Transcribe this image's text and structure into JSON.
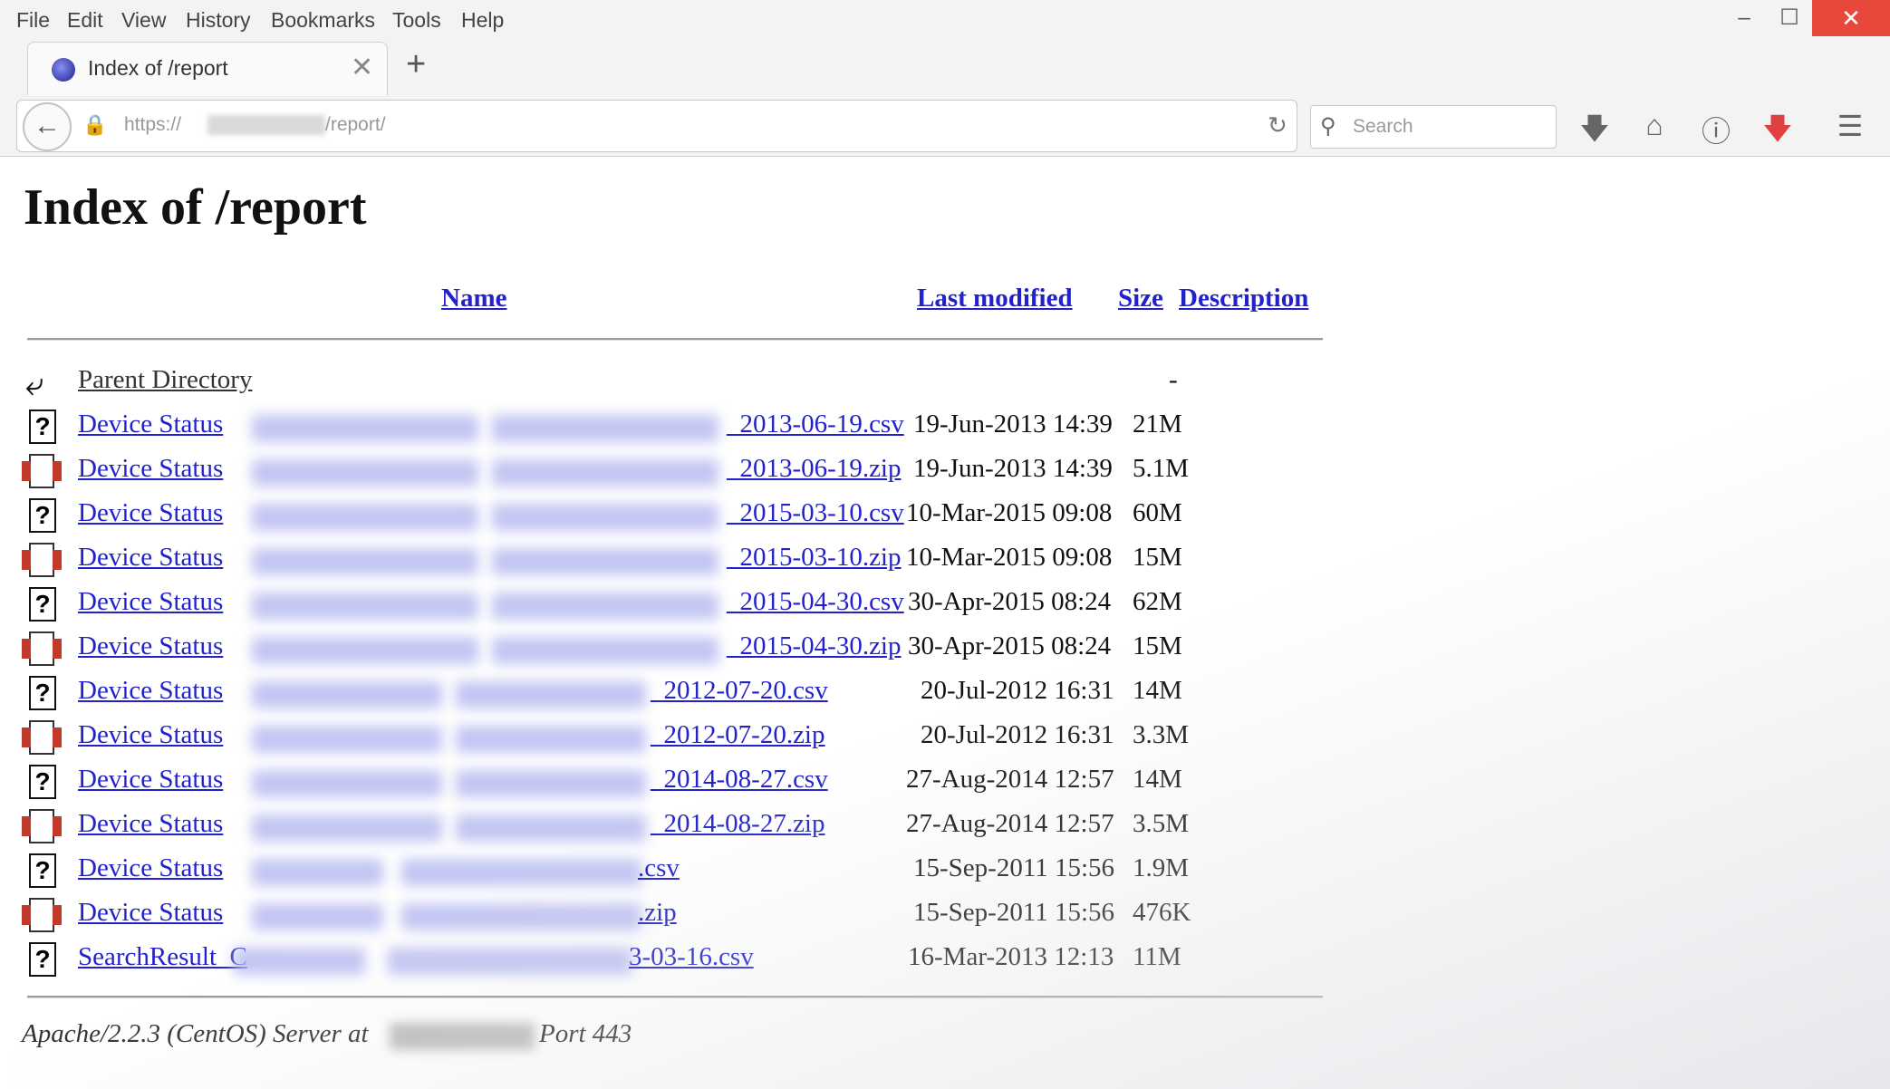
{
  "menubar": [
    "File",
    "Edit",
    "View",
    "History",
    "Bookmarks",
    "Tools",
    "Help"
  ],
  "window": {
    "minimize": "–",
    "maximize": "☐",
    "close": "✕"
  },
  "tab": {
    "title": "Index of /report",
    "close": "✕",
    "new_tab": "+"
  },
  "urlbar": {
    "prefix": "https://",
    "path": "/report/"
  },
  "search": {
    "placeholder": "Search"
  },
  "page": {
    "heading": "Index of /report",
    "columns": {
      "name": "Name",
      "modified": "Last modified",
      "size": "Size",
      "description": "Description"
    },
    "parent": {
      "label": "Parent Directory",
      "size": "-"
    },
    "rows": [
      {
        "type": "csv",
        "prefix": "Device  Status  ",
        "suffix": "_2013-06-19.csv",
        "date": "19-Jun-2013 14:39",
        "size": "21M"
      },
      {
        "type": "zip",
        "prefix": "Device  Status  ",
        "suffix": "_2013-06-19.zip",
        "date": "19-Jun-2013 14:39",
        "size": "5.1M"
      },
      {
        "type": "csv",
        "prefix": "Device  Status  ",
        "suffix": "_2015-03-10.csv",
        "date": "10-Mar-2015 09:08",
        "size": "60M"
      },
      {
        "type": "zip",
        "prefix": "Device  Status  ",
        "suffix": "_2015-03-10.zip",
        "date": "10-Mar-2015 09:08",
        "size": "15M"
      },
      {
        "type": "csv",
        "prefix": "Device  Status  ",
        "suffix": "_2015-04-30.csv",
        "date": "30-Apr-2015 08:24",
        "size": "62M"
      },
      {
        "type": "zip",
        "prefix": "Device  Status  ",
        "suffix": "_2015-04-30.zip",
        "date": "30-Apr-2015 08:24",
        "size": "15M"
      },
      {
        "type": "csv",
        "prefix": "Device  Status  ",
        "suffix": "_2012-07-20.csv",
        "date": "20-Jul-2012 16:31",
        "size": "14M"
      },
      {
        "type": "zip",
        "prefix": "Device  Status  ",
        "suffix": "_2012-07-20.zip",
        "date": "20-Jul-2012 16:31",
        "size": "3.3M"
      },
      {
        "type": "csv",
        "prefix": "Device  Status  ",
        "suffix": "_2014-08-27.csv",
        "date": "27-Aug-2014 12:57",
        "size": "14M"
      },
      {
        "type": "zip",
        "prefix": "Device  Status  ",
        "suffix": "_2014-08-27.zip",
        "date": "27-Aug-2014 12:57",
        "size": "3.5M"
      },
      {
        "type": "csv",
        "prefix": "Device  Status  ",
        "suffix": ".csv",
        "date": "15-Sep-2011 15:56",
        "size": "1.9M"
      },
      {
        "type": "zip",
        "prefix": "Device  Status  ",
        "suffix": ".zip",
        "date": "15-Sep-2011 15:56",
        "size": "476K"
      },
      {
        "type": "csv",
        "prefix": "SearchResult_C",
        "suffix": "3-03-16.csv",
        "date": "16-Mar-2013 12:13",
        "size": "11M"
      }
    ],
    "footer": {
      "text": "Apache/2.2.3 (CentOS) Server at",
      "port": "Port 443"
    }
  },
  "colors": {
    "link": "#2222cc",
    "close_button": "#e8473c",
    "pocket": "#e04040"
  }
}
